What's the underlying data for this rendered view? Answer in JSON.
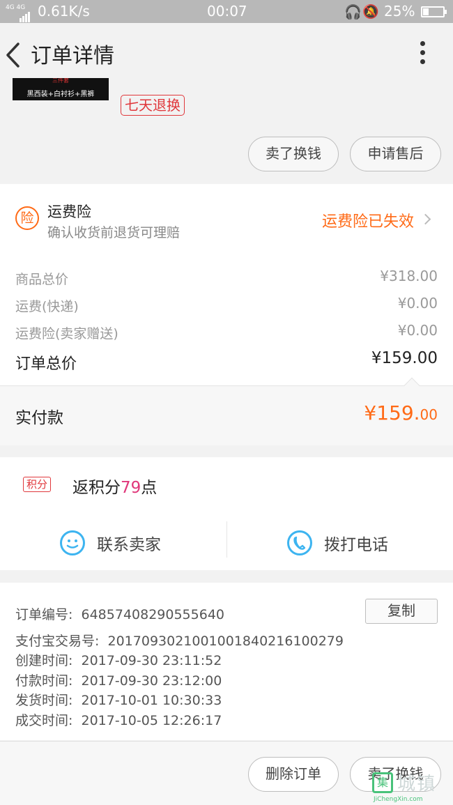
{
  "status_bar": {
    "network": "4G 4G",
    "speed": "0.61K/s",
    "time": "00:07",
    "battery": "25%"
  },
  "header": {
    "title": "订单详情"
  },
  "product": {
    "thumb_tag": "三件套",
    "thumb_caption": "黑西装+白衬衫+黑裤",
    "badge": "七天退换",
    "btn_sell": "卖了换钱",
    "btn_aftersale": "申请售后"
  },
  "insurance": {
    "icon_char": "险",
    "title": "运费险",
    "subtitle": "确认收货前退货可理赔",
    "status": "运费险已失效"
  },
  "prices": {
    "rows": [
      {
        "label": "商品总价",
        "value": "¥318.00"
      },
      {
        "label": "运费(快递)",
        "value": "¥0.00"
      },
      {
        "label": "运费险(卖家赠送)",
        "value": "¥0.00"
      }
    ],
    "total_label": "订单总价",
    "total_value": "¥159.00",
    "paid_label": "实付款",
    "paid_big": "¥159.",
    "paid_small": "00"
  },
  "points": {
    "icon_text": "积分",
    "prefix": "返积分",
    "amount": "79",
    "suffix": "点"
  },
  "contact": {
    "seller": "联系卖家",
    "call": "拨打电话"
  },
  "order_info": {
    "order_no_label": "订单编号:",
    "order_no": "64857408290555640",
    "copy": "复制",
    "alipay_label": "支付宝交易号:",
    "alipay_no": "2017093021001001840216100279",
    "created_label": "创建时间:",
    "created": "2017-09-30 23:11:52",
    "paid_label": "付款时间:",
    "paid": "2017-09-30 23:12:00",
    "shipped_label": "发货时间:",
    "shipped": "2017-10-01 10:30:33",
    "done_label": "成交时间:",
    "done": "2017-10-05 12:26:17"
  },
  "footer": {
    "delete": "删除订单",
    "sell": "卖了换钱"
  },
  "watermark": {
    "icon_char": "集",
    "cn": "城镇",
    "en": "JiChengXin.com"
  },
  "colors": {
    "accent_orange": "#ff6a16",
    "badge_red": "#e0373b",
    "points_pink": "#e0377a",
    "contact_blue": "#3db4f0"
  }
}
